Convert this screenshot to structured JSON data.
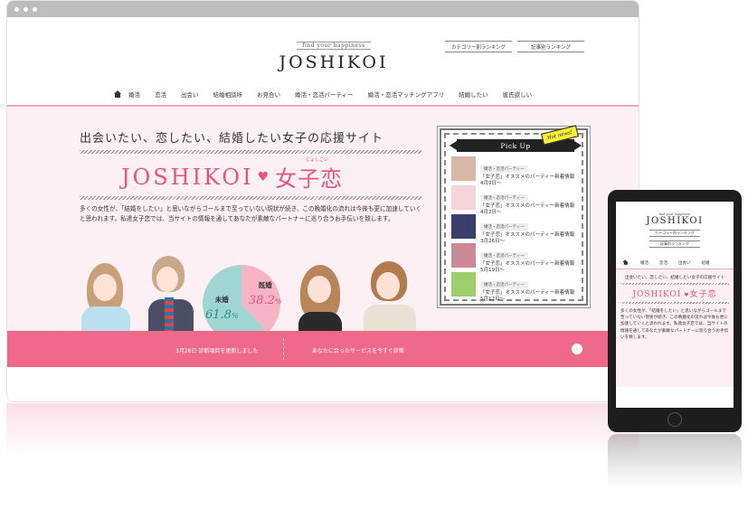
{
  "browser": {
    "window_dots": 3
  },
  "header": {
    "logo_tagline": "find your happiness",
    "logo": "JOSHIKOI",
    "category_ranking": "カテゴリー別ランキング",
    "article_ranking": "記事別ランキング"
  },
  "nav": {
    "items": [
      "婚活",
      "恋活",
      "出会い",
      "結婚相談所",
      "お見合い",
      "婚活・恋活パーティー",
      "婚活・恋活マッチングアプリ",
      "結婚したい",
      "彼氏欲しい"
    ]
  },
  "hero": {
    "title": "出会いたい、恋したい、結婚したい女子の応援サイト",
    "logo_latin": "JOSHIKOI",
    "logo_kanji": "女子恋",
    "logo_ruby": "じょしこい",
    "text": "多くの女性が、「結婚をしたい」と思いながらゴールまで至っていない現状が続き、この晩婚化の流れは今後も更に加速していくと思われます。私達女子恋では、当サイトの情報を通してあなたが素敵なパートナーに巡り合うお手伝いを致します。"
  },
  "chart_data": {
    "type": "pie",
    "categories": [
      "既婚",
      "未婚"
    ],
    "values": [
      38.2,
      61.8
    ],
    "colors": [
      "#f7b4c6",
      "#9fd6d2"
    ],
    "labels": [
      {
        "name": "既婚",
        "value": "38.2",
        "unit": "%"
      },
      {
        "name": "未婚",
        "value": "61.8",
        "unit": "%"
      }
    ]
  },
  "pickup": {
    "heading": "Pick Up",
    "badge": "Hot news!",
    "items": [
      {
        "category": "婚活・恋活パーティー",
        "title": "「女子恋」オススメのパーティー新着情報　4月9日～",
        "thumb": "#d9b7a6"
      },
      {
        "category": "婚活・恋活パーティー",
        "title": "「女子恋」オススメのパーティー新着情報　4月2日～",
        "thumb": "#f3d4da"
      },
      {
        "category": "婚活・恋活パーティー",
        "title": "「女子恋」オススメのパーティー新着情報　3月26日～",
        "thumb": "#3a3f6e"
      },
      {
        "category": "婚活・恋活パーティー",
        "title": "「女子恋」オススメのパーティー新着情報　5月19日～",
        "thumb": "#c98a96"
      },
      {
        "category": "婚活・恋活パーティー",
        "title": "「女子恋」オススメのパーティー新着情報　5月12日～",
        "thumb": "#9ccf6a"
      }
    ]
  },
  "bottom_bar": {
    "news": "3月26日 診断項目を更新しました",
    "service": "あなたに合ったサービスを今すぐ診断",
    "arrow_icon": "chevron-right-icon",
    "color": "#ef6a8a"
  },
  "tablet": {
    "logo_tagline": "find your happiness",
    "logo": "JOSHIKOI",
    "category_ranking": "カテゴリー別ランキング",
    "article_ranking": "記事別ランキング",
    "nav": [
      "婚活",
      "恋活",
      "出会い",
      "結婚"
    ],
    "title": "出会いたい、恋したい、結婚したい女子の応援サイト",
    "logo_latin": "JOSHIKOI",
    "logo_kanji": "女子恋",
    "text": "多くの女性が、「結婚をしたい」と思いながらゴールまで至っていない現状が続き、この晩婚化の流れは今後も更に加速していくと思われます。私達女子恋では、当サイトの情報を通してあなたが素敵なパートナーに巡り合うお手伝いを致します。"
  }
}
